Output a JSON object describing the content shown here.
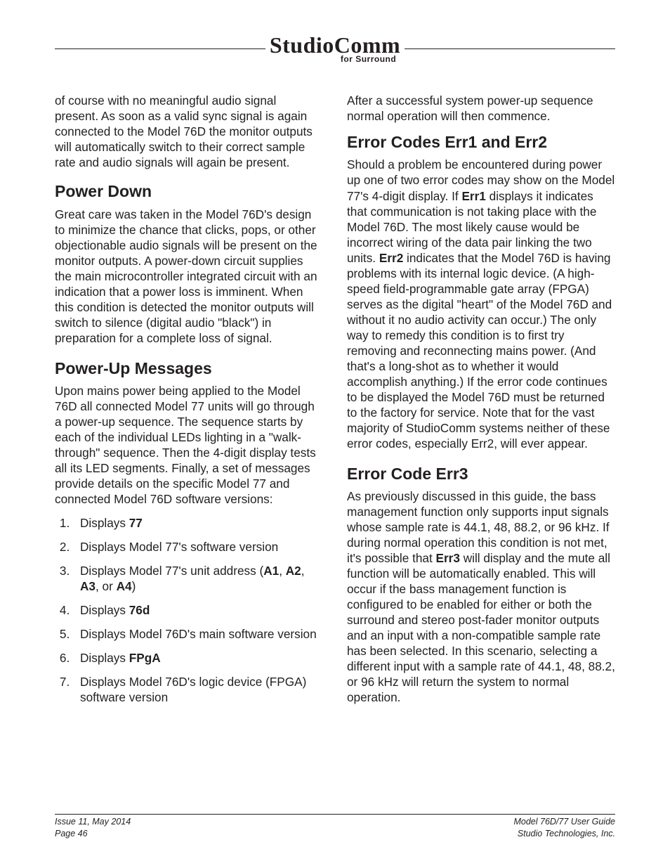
{
  "logo": {
    "main": "StudioComm",
    "sub": "for Surround"
  },
  "left": {
    "intro": "of course with no meaningful audio signal present. As soon as a valid sync signal is again connected to the Model 76D the monitor outputs will automatically switch to their correct sample rate and audio signals will again be present.",
    "h_powerdown": "Power Down",
    "p_powerdown": "Great care was taken in the Model 76D's design to minimize the chance that clicks, pops, or other objectionable audio signals will be present on the monitor outputs. A power-down circuit supplies the main microcontroller integrated circuit with an indication that a power loss is imminent. When this condition is detected the monitor outputs will switch to silence (digital audio \"black\") in preparation for a complete loss of signal.",
    "h_powerup": "Power-Up Messages",
    "p_powerup": "Upon mains power being applied to the Model 76D all connected Model 77 units will go through a power-up sequence. The sequence starts by each of the individual LEDs lighting in a \"walk-through\" sequence. Then the 4-digit display tests all its LED segments. Finally, a set of messages provide details on the specific Model 77 and connected Model 76D software versions:",
    "li1_a": "Displays ",
    "li1_b": "77",
    "li2": "Displays Model 77's software version",
    "li3_a": "Displays Model 77's unit address (",
    "li3_b": "A1",
    "li3_c": ", ",
    "li3_d": "A2",
    "li3_e": ", ",
    "li3_f": "A3",
    "li3_g": ", or ",
    "li3_h": "A4",
    "li3_i": ")",
    "li4_a": "Displays ",
    "li4_b": "76d",
    "li5": "Displays Model 76D's main software version",
    "li6_a": "Displays ",
    "li6_b": "FPgA",
    "li7": "Displays Model 76D's logic device (FPGA) software version"
  },
  "right": {
    "p_after": "After a successful system power-up sequence normal operation will then commence.",
    "h_err12": "Error Codes Err1 and Err2",
    "err12_a": "Should a problem be encountered during power up one of two error codes may show on the Model 77's 4-digit display. If ",
    "err12_b": "Err1",
    "err12_c": " displays it indicates that communication is not taking place with the Model 76D. The most likely cause would be incorrect wiring of the data pair linking the two units. ",
    "err12_d": "Err2",
    "err12_e": " indicates that the Model 76D is having problems with its internal logic device. (A high-speed field-programmable gate array (FPGA) serves as the digital \"heart\" of the Model 76D and without it no audio activity can occur.) The only way to remedy this condition is to first try removing and reconnecting mains power. (And that's a long-shot as to whether it would accomplish anything.) If the error code continues to be displayed the Model 76D must be returned to the factory for service. Note that for the vast majority of StudioComm systems neither of these error codes, especially Err2, will ever appear.",
    "h_err3": "Error Code Err3",
    "err3_a": "As previously discussed in this guide, the bass management function only supports input signals whose sample rate is 44.1, 48, 88.2, or 96 kHz. If during normal operation this condition is not met, it's possible that ",
    "err3_b": "Err3",
    "err3_c": " will display and the mute all function will be automatically enabled. This will occur if the bass management function is configured to be enabled for either or both the surround and stereo post-fader monitor outputs and an input with a non-compatible sample rate has been selected. In this scenario, selecting a different input with a sample rate of 44.1, 48, 88.2, or 96 kHz will return the system to normal operation."
  },
  "footer": {
    "left1": "Issue 11, May 2014",
    "left2": "Page 46",
    "right1": "Model 76D/77 User Guide",
    "right2": "Studio Technologies, Inc."
  }
}
